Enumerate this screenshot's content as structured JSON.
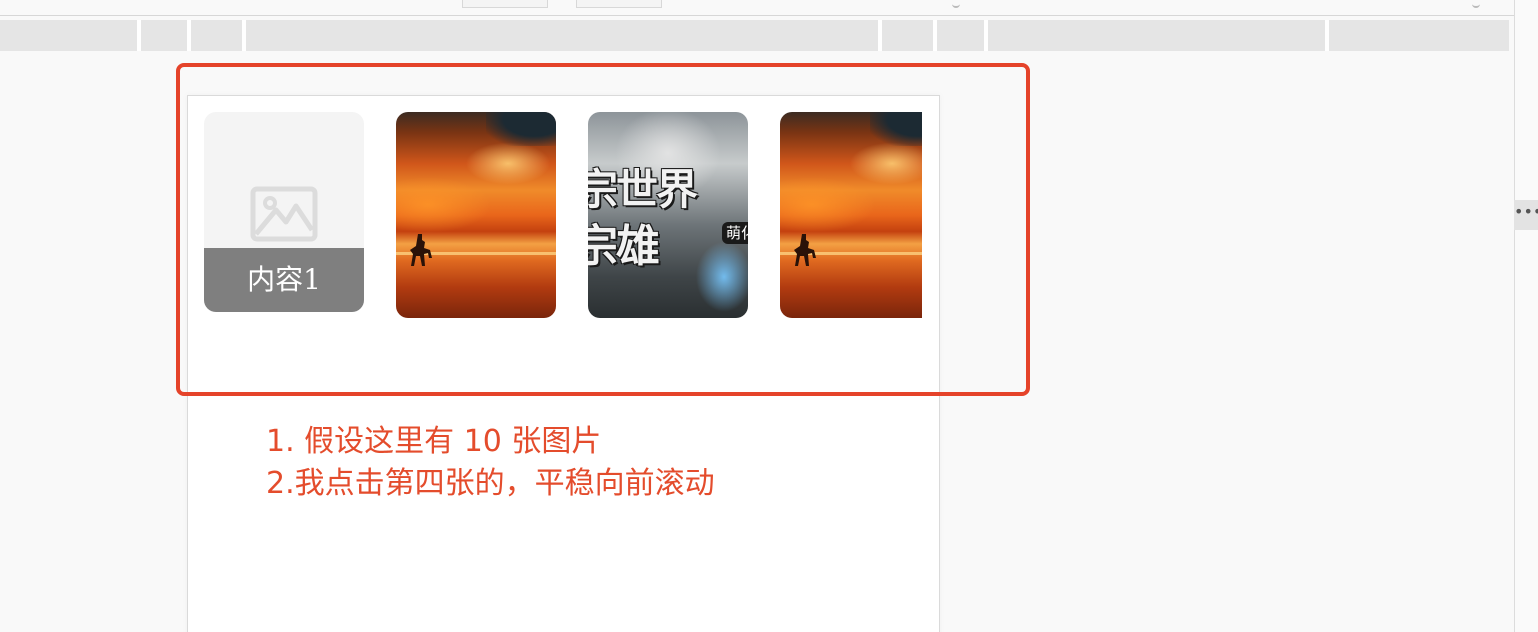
{
  "toolbar": {
    "buttons": [
      "",
      ""
    ]
  },
  "column_header": {
    "columns": [
      "",
      "",
      "",
      "",
      "",
      "",
      "",
      ""
    ]
  },
  "scrollbar": {
    "overflow_glyph": "•••"
  },
  "carousel": {
    "items": [
      {
        "type": "placeholder",
        "caption": "内容1",
        "icon": "image-placeholder-icon"
      },
      {
        "type": "image",
        "image": "sunset-rider-image"
      },
      {
        "type": "image",
        "image": "game-poster-image",
        "poster_lines": [
          "宗世界",
          "宗雄"
        ],
        "poster_tag": "萌化"
      },
      {
        "type": "image",
        "image": "sunset-rider-image"
      }
    ]
  },
  "highlight": {
    "color": "#e5432a"
  },
  "annotation": {
    "color": "#e44c2c",
    "line1": "1. 假设这里有 10 张图片",
    "line2": "2.我点击第四张的，平稳向前滚动"
  }
}
